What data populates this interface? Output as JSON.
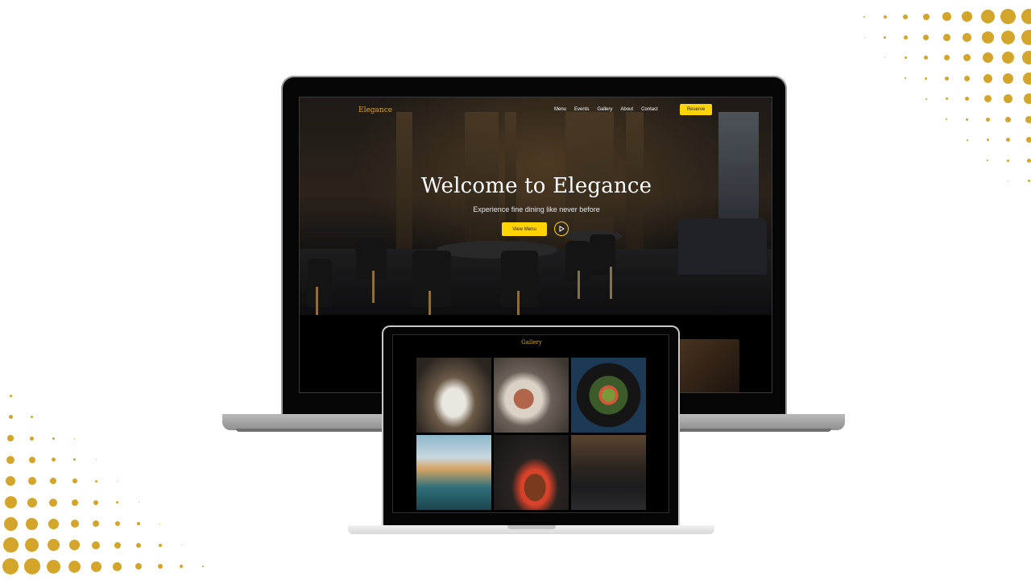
{
  "colors": {
    "accent_gold": "#d4a52b",
    "button_yellow": "#ffd400",
    "screen_black": "#000000"
  },
  "laptop_site": {
    "logo": "Elegance",
    "nav_items": [
      "Menu",
      "Events",
      "Gallery",
      "About",
      "Contact"
    ],
    "reserve_label": "Reserve",
    "hero_title": "Welcome to Elegance",
    "hero_subtitle": "Experience fine dining like never before",
    "view_menu_label": "View Menu",
    "play_icon": "play-icon"
  },
  "tablet_site": {
    "gallery_title": "Gallery",
    "gallery_items": [
      "plated-dish-photo",
      "steak-salad-photo",
      "salad-bowl-photo",
      "terrace-dining-photo",
      "ribs-platter-photo",
      "restaurant-interior-photo"
    ]
  }
}
